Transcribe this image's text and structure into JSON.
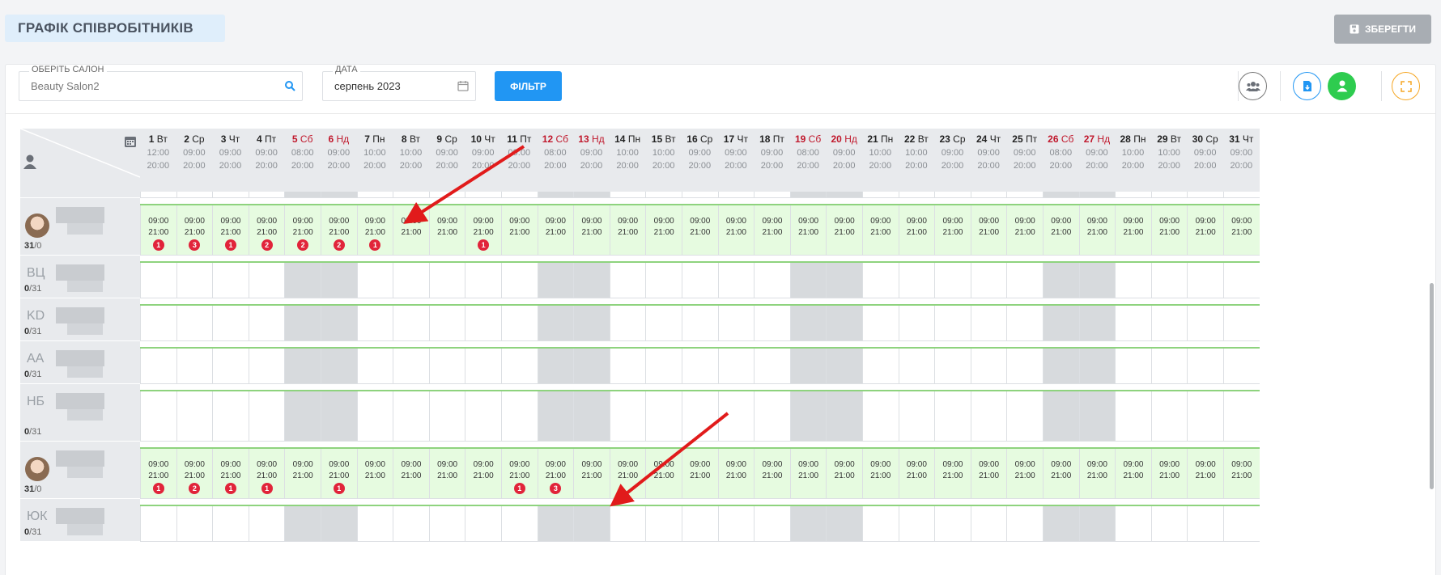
{
  "header": {
    "title": "ГРАФІК СПІВРОБІТНИКІВ",
    "save_label": "ЗБЕРЕГТИ"
  },
  "filters": {
    "salon": {
      "label": "ОБЕРІТЬ САЛОН",
      "value": "Beauty Salon2"
    },
    "date": {
      "label": "ДАТА",
      "value": "серпень 2023"
    },
    "filter_label": "ФІЛЬТР"
  },
  "colors": {
    "accent": "#2196f3",
    "weekend": "#c0182c",
    "badge": "#e1243a",
    "work_cell": "#e6fbe0",
    "off_cell": "#d7dadd",
    "green_btn": "#2ecc4f"
  },
  "days": [
    {
      "d": "1",
      "w": "Вт",
      "s": "12:00",
      "e": "20:00",
      "we": false
    },
    {
      "d": "2",
      "w": "Ср",
      "s": "09:00",
      "e": "20:00",
      "we": false
    },
    {
      "d": "3",
      "w": "Чт",
      "s": "09:00",
      "e": "20:00",
      "we": false
    },
    {
      "d": "4",
      "w": "Пт",
      "s": "09:00",
      "e": "20:00",
      "we": false
    },
    {
      "d": "5",
      "w": "Сб",
      "s": "08:00",
      "e": "20:00",
      "we": true
    },
    {
      "d": "6",
      "w": "Нд",
      "s": "09:00",
      "e": "20:00",
      "we": true
    },
    {
      "d": "7",
      "w": "Пн",
      "s": "10:00",
      "e": "20:00",
      "we": false
    },
    {
      "d": "8",
      "w": "Вт",
      "s": "10:00",
      "e": "20:00",
      "we": false
    },
    {
      "d": "9",
      "w": "Ср",
      "s": "09:00",
      "e": "20:00",
      "we": false
    },
    {
      "d": "10",
      "w": "Чт",
      "s": "09:00",
      "e": "20:00",
      "we": false
    },
    {
      "d": "11",
      "w": "Пт",
      "s": "09:00",
      "e": "20:00",
      "we": false
    },
    {
      "d": "12",
      "w": "Сб",
      "s": "08:00",
      "e": "20:00",
      "we": true
    },
    {
      "d": "13",
      "w": "Нд",
      "s": "09:00",
      "e": "20:00",
      "we": true
    },
    {
      "d": "14",
      "w": "Пн",
      "s": "10:00",
      "e": "20:00",
      "we": false
    },
    {
      "d": "15",
      "w": "Вт",
      "s": "10:00",
      "e": "20:00",
      "we": false
    },
    {
      "d": "16",
      "w": "Ср",
      "s": "09:00",
      "e": "20:00",
      "we": false
    },
    {
      "d": "17",
      "w": "Чт",
      "s": "09:00",
      "e": "20:00",
      "we": false
    },
    {
      "d": "18",
      "w": "Пт",
      "s": "09:00",
      "e": "20:00",
      "we": false
    },
    {
      "d": "19",
      "w": "Сб",
      "s": "08:00",
      "e": "20:00",
      "we": true
    },
    {
      "d": "20",
      "w": "Нд",
      "s": "09:00",
      "e": "20:00",
      "we": true
    },
    {
      "d": "21",
      "w": "Пн",
      "s": "10:00",
      "e": "20:00",
      "we": false
    },
    {
      "d": "22",
      "w": "Вт",
      "s": "10:00",
      "e": "20:00",
      "we": false
    },
    {
      "d": "23",
      "w": "Ср",
      "s": "09:00",
      "e": "20:00",
      "we": false
    },
    {
      "d": "24",
      "w": "Чт",
      "s": "09:00",
      "e": "20:00",
      "we": false
    },
    {
      "d": "25",
      "w": "Пт",
      "s": "09:00",
      "e": "20:00",
      "we": false
    },
    {
      "d": "26",
      "w": "Сб",
      "s": "08:00",
      "e": "20:00",
      "we": true
    },
    {
      "d": "27",
      "w": "Нд",
      "s": "09:00",
      "e": "20:00",
      "we": true
    },
    {
      "d": "28",
      "w": "Пн",
      "s": "10:00",
      "e": "20:00",
      "we": false
    },
    {
      "d": "29",
      "w": "Вт",
      "s": "10:00",
      "e": "20:00",
      "we": false
    },
    {
      "d": "30",
      "w": "Ср",
      "s": "09:00",
      "e": "20:00",
      "we": false
    },
    {
      "d": "31",
      "w": "Чт",
      "s": "09:00",
      "e": "20:00",
      "we": false
    }
  ],
  "employees": [
    {
      "initials": "",
      "avatar": true,
      "count": "31",
      "suffix": "/0",
      "shift": [
        "09:00",
        "21:00"
      ],
      "badges": {
        "1": "1",
        "2": "3",
        "3": "1",
        "4": "2",
        "5": "2",
        "6": "2",
        "7": "1",
        "10": "1"
      }
    },
    {
      "initials": "ВЦ",
      "avatar": false,
      "count": "0",
      "suffix": "/31",
      "shift": null,
      "badges": {}
    },
    {
      "initials": "KD",
      "avatar": false,
      "count": "0",
      "suffix": "/31",
      "shift": null,
      "badges": {}
    },
    {
      "initials": "AA",
      "avatar": false,
      "count": "0",
      "suffix": "/31",
      "shift": null,
      "badges": {}
    },
    {
      "initials": "НБ",
      "avatar": false,
      "count": "0",
      "suffix": "/31",
      "shift": null,
      "badges": {}
    },
    {
      "initials": "",
      "avatar": true,
      "count": "31",
      "suffix": "/0",
      "shift": [
        "09:00",
        "21:00"
      ],
      "badges": {
        "1": "1",
        "2": "2",
        "3": "1",
        "4": "1",
        "6": "1",
        "11": "1",
        "12": "3"
      }
    },
    {
      "initials": "ЮК",
      "avatar": false,
      "count": "0",
      "suffix": "/31",
      "shift": null,
      "badges": {}
    }
  ]
}
